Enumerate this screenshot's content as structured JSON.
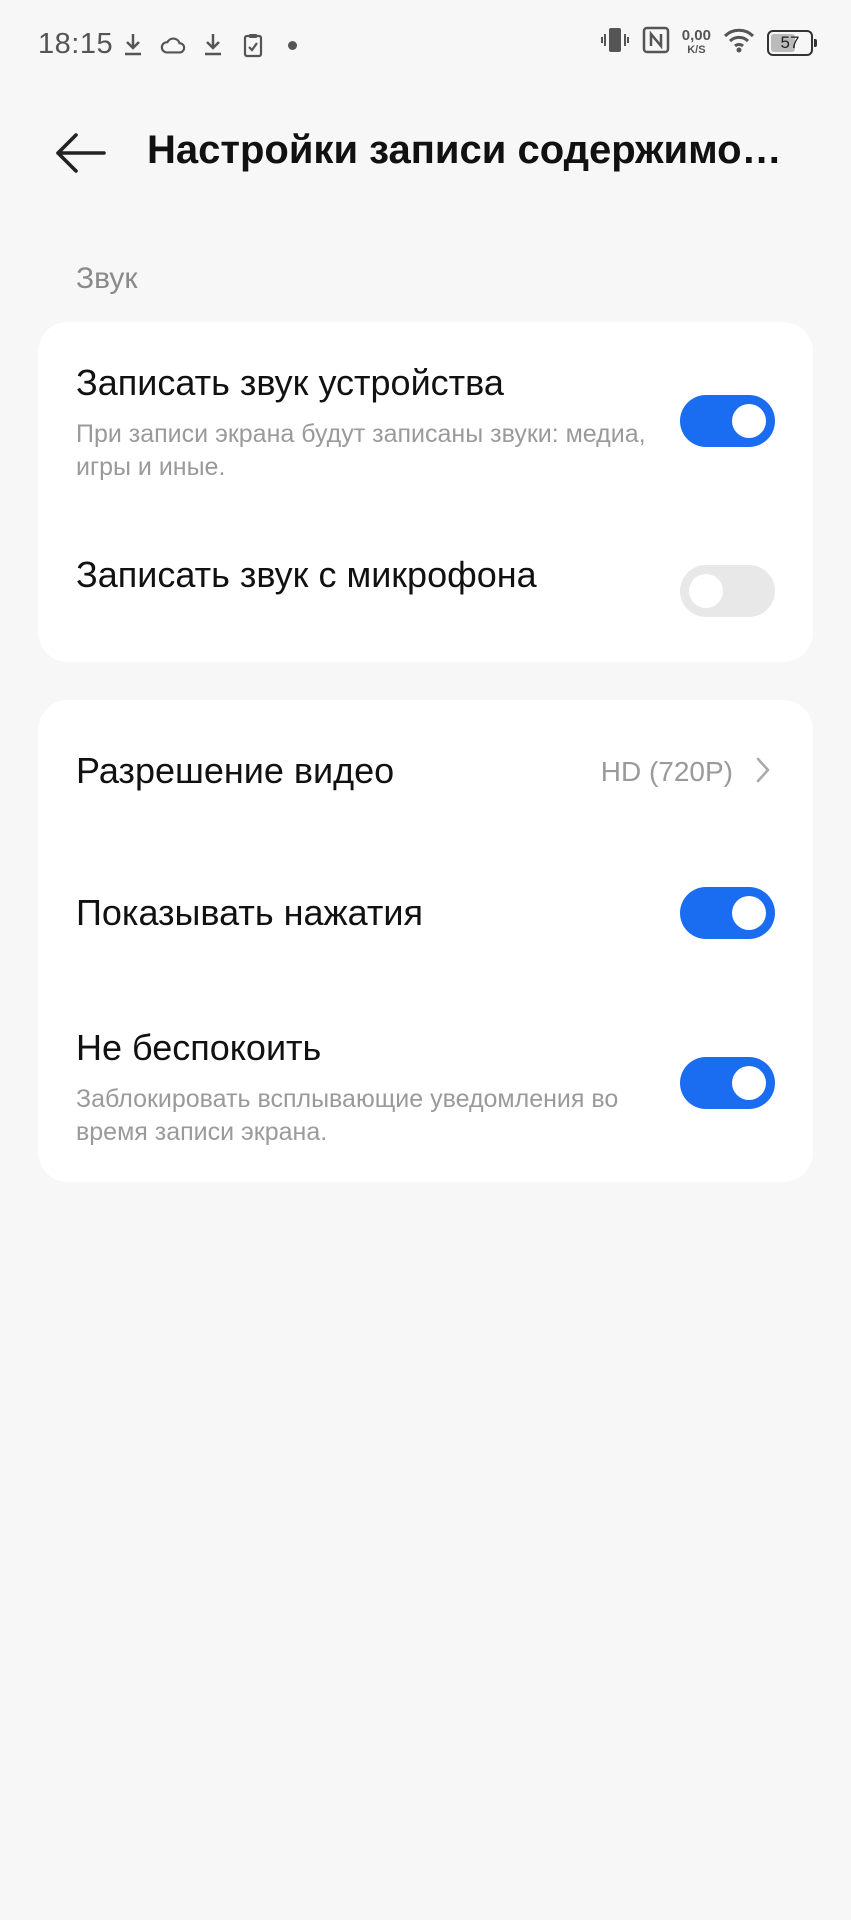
{
  "status_bar": {
    "time": "18:15",
    "left_icons": [
      "download-icon",
      "cloud-icon",
      "download-icon",
      "clipboard-check-icon",
      "dot-icon"
    ],
    "right_icons": [
      "vibrate-icon",
      "nfc-icon",
      "wifi-icon",
      "battery-icon"
    ],
    "net_speed_value": "0,00",
    "net_speed_unit": "K/S",
    "battery_level": "57"
  },
  "header": {
    "title": "Настройки записи содержимо…"
  },
  "sound_section": {
    "label": "Звук",
    "items": [
      {
        "title": "Записать звук устройства",
        "subtitle": "При записи экрана будут записаны звуки: медиа, игры и иные.",
        "enabled": true
      },
      {
        "title": "Записать звук с микрофона",
        "enabled": false
      }
    ]
  },
  "video_section": {
    "items": [
      {
        "title": "Разрешение видео",
        "value": "HD (720P)"
      },
      {
        "title": "Показывать нажатия",
        "enabled": true
      },
      {
        "title": "Не беспокоить",
        "subtitle": "Заблокировать всплывающие уведомления во время записи экрана.",
        "enabled": true
      }
    ]
  },
  "colors": {
    "accent": "#1a6cf0",
    "toggle_off": "#e8e8e8",
    "background": "#f7f7f7",
    "card": "#ffffff",
    "secondary_text": "#9a9a9a"
  }
}
